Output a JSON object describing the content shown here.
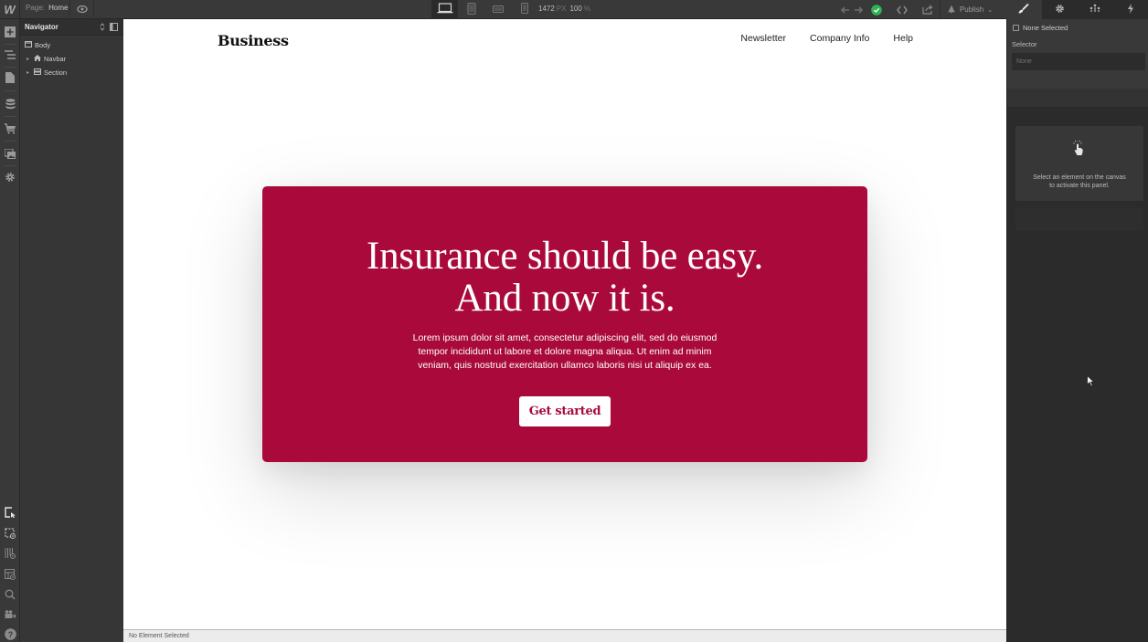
{
  "topbar": {
    "logo": "W",
    "page_prefix": "Page:",
    "page_name": "Home",
    "preview_icon": "eye-icon",
    "devices": [
      "desktop-icon",
      "tablet-icon",
      "mobile-landscape-icon",
      "mobile-portrait-icon"
    ],
    "active_device": "desktop",
    "canvas_width": "1472",
    "canvas_width_unit": "PX",
    "zoom": "100",
    "zoom_unit": "%",
    "publish_label": "Publish",
    "status_color": "#2fb356"
  },
  "panel_tabs": [
    "style-brush-icon",
    "settings-gear-icon",
    "interactions-icon",
    "lightning-icon"
  ],
  "navigator": {
    "title": "Navigator",
    "tree": [
      {
        "label": "Body",
        "icon": "body-icon",
        "level": 0
      },
      {
        "label": "Navbar",
        "icon": "home-icon",
        "level": 1
      },
      {
        "label": "Section",
        "icon": "section-icon",
        "level": 1
      }
    ]
  },
  "site": {
    "brand": "Business",
    "nav": [
      "Newsletter",
      "Company Info",
      "Help"
    ],
    "hero": {
      "title_line1": "Insurance should be easy.",
      "title_line2": "And now it is.",
      "body": "Lorem ipsum dolor sit amet, consectetur adipiscing elit, sed do eiusmod tempor incididunt ut labore et dolore magna aliqua. Ut enim ad minim veniam, quis nostrud exercitation ullamco laboris nisi ut aliquip ex ea.",
      "cta": "Get started",
      "color": "#a90a3b"
    }
  },
  "statusbar": {
    "text": "No Element Selected"
  },
  "right_panel": {
    "none_selected": "None Selected",
    "selector_label": "Selector",
    "selector_placeholder": "None",
    "empty_message_line1": "Select an element on the canvas",
    "empty_message_line2": "to activate this panel."
  }
}
